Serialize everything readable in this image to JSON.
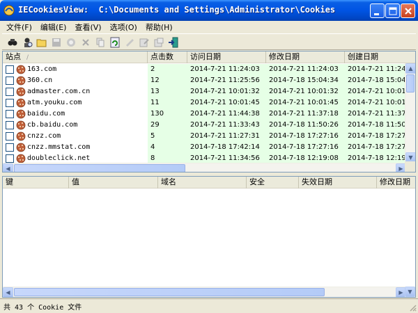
{
  "window": {
    "title": "IECookiesView:  C:\\Documents and Settings\\Administrator\\Cookies",
    "accent_color": "#0054e3"
  },
  "menu": [
    "文件(F)",
    "编辑(E)",
    "查看(V)",
    "选项(O)",
    "帮助(H)"
  ],
  "toolbar_icons": [
    "find-icon",
    "properties-icon",
    "open-folder-icon",
    "save-icon",
    "block-icon",
    "delete-icon",
    "copy-icon",
    "refresh-icon",
    "cookie-edit-icon",
    "edit-icon",
    "options-icon",
    "exit-icon"
  ],
  "top_list": {
    "columns": [
      "站点",
      "点击数",
      "访问日期",
      "修改日期",
      "创建日期"
    ],
    "sort_indicator": "/",
    "rows": [
      {
        "site": "163.com",
        "hits": "2",
        "accessed": "2014-7-21 11:24:03",
        "modified": "2014-7-21 11:24:03",
        "created": "2014-7-21 11:24"
      },
      {
        "site": "360.cn",
        "hits": "12",
        "accessed": "2014-7-21 11:25:56",
        "modified": "2014-7-18 15:04:34",
        "created": "2014-7-18 15:04"
      },
      {
        "site": "admaster.com.cn",
        "hits": "13",
        "accessed": "2014-7-21 10:01:32",
        "modified": "2014-7-21 10:01:32",
        "created": "2014-7-21 10:01"
      },
      {
        "site": "atm.youku.com",
        "hits": "11",
        "accessed": "2014-7-21 10:01:45",
        "modified": "2014-7-21 10:01:45",
        "created": "2014-7-21 10:01"
      },
      {
        "site": "baidu.com",
        "hits": "130",
        "accessed": "2014-7-21 11:44:38",
        "modified": "2014-7-21 11:37:18",
        "created": "2014-7-21 11:37"
      },
      {
        "site": "cb.baidu.com",
        "hits": "29",
        "accessed": "2014-7-21 11:33:43",
        "modified": "2014-7-18 11:50:26",
        "created": "2014-7-18 11:50"
      },
      {
        "site": "cnzz.com",
        "hits": "5",
        "accessed": "2014-7-21 11:27:31",
        "modified": "2014-7-18 17:27:16",
        "created": "2014-7-18 17:27"
      },
      {
        "site": "cnzz.mmstat.com",
        "hits": "4",
        "accessed": "2014-7-18 17:42:14",
        "modified": "2014-7-18 17:27:16",
        "created": "2014-7-18 17:27"
      },
      {
        "site": "doubleclick.net",
        "hits": "8",
        "accessed": "2014-7-21 11:34:56",
        "modified": "2014-7-18 12:19:08",
        "created": "2014-7-18 12:19"
      }
    ]
  },
  "bottom_list": {
    "columns": [
      "键",
      "值",
      "域名",
      "安全",
      "失效日期",
      "修改日期"
    ]
  },
  "status": {
    "text": "共 43 个 Cookie 文件"
  }
}
